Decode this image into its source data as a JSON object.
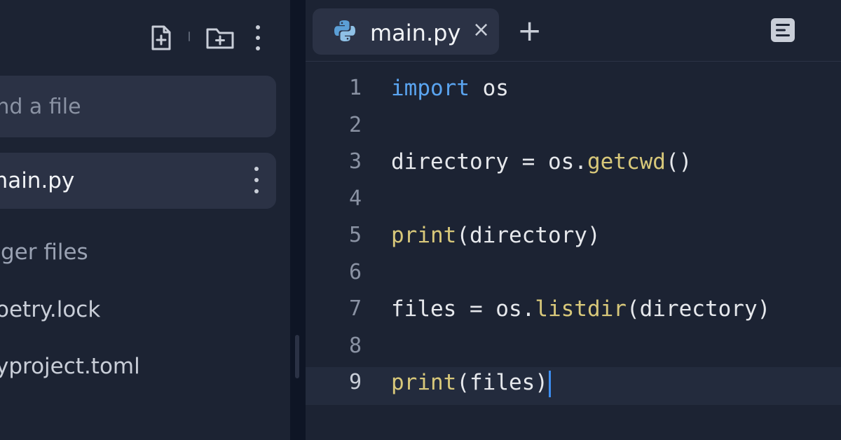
{
  "sidebar": {
    "search": {
      "placeholder": "ind a file"
    },
    "files": [
      {
        "name": "main.py"
      }
    ],
    "packager_section": {
      "label": "ager files",
      "items": [
        "oetry.lock",
        "yproject.toml"
      ]
    },
    "icons": {
      "new_file": "file-plus-icon",
      "new_folder": "folder-plus-icon",
      "menu": "kebab-menu-icon"
    }
  },
  "editor": {
    "tabs": [
      {
        "label": "main.py",
        "icon": "python-icon",
        "close": "×"
      }
    ],
    "new_tab_label": "+",
    "format_icon": "format-icon",
    "active_line": 9,
    "lines": [
      {
        "num": "1",
        "tokens": [
          {
            "t": "kw",
            "v": "import"
          },
          {
            "t": "plain",
            "v": " os"
          }
        ]
      },
      {
        "num": "2",
        "tokens": []
      },
      {
        "num": "3",
        "tokens": [
          {
            "t": "plain",
            "v": "directory = os."
          },
          {
            "t": "fn",
            "v": "getcwd"
          },
          {
            "t": "punct",
            "v": "()"
          }
        ]
      },
      {
        "num": "4",
        "tokens": []
      },
      {
        "num": "5",
        "tokens": [
          {
            "t": "fn",
            "v": "print"
          },
          {
            "t": "punct",
            "v": "(directory)"
          }
        ]
      },
      {
        "num": "6",
        "tokens": []
      },
      {
        "num": "7",
        "tokens": [
          {
            "t": "plain",
            "v": "files = os."
          },
          {
            "t": "fn",
            "v": "listdir"
          },
          {
            "t": "punct",
            "v": "(directory)"
          }
        ]
      },
      {
        "num": "8",
        "tokens": []
      },
      {
        "num": "9",
        "tokens": [
          {
            "t": "fn",
            "v": "print"
          },
          {
            "t": "punct",
            "v": "(files)"
          }
        ]
      }
    ]
  },
  "colors": {
    "background": "#1c2333",
    "panel": "#2b3245",
    "keyword": "#5aa4f0",
    "function": "#d8c87a",
    "cursor": "#3d8ef0"
  }
}
